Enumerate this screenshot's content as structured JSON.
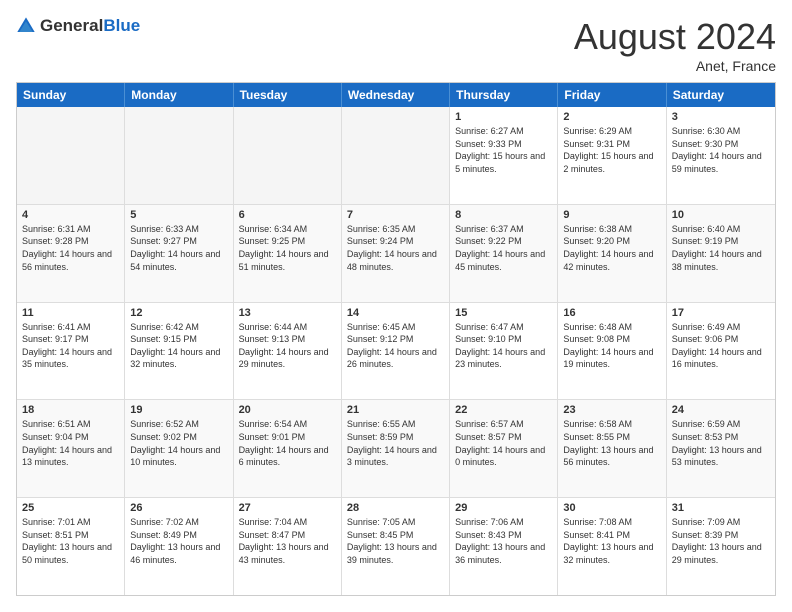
{
  "header": {
    "logo_general": "General",
    "logo_blue": "Blue",
    "month_year": "August 2024",
    "location": "Anet, France"
  },
  "days": [
    "Sunday",
    "Monday",
    "Tuesday",
    "Wednesday",
    "Thursday",
    "Friday",
    "Saturday"
  ],
  "rows": [
    [
      {
        "date": "",
        "empty": true
      },
      {
        "date": "",
        "empty": true
      },
      {
        "date": "",
        "empty": true
      },
      {
        "date": "",
        "empty": true
      },
      {
        "date": "1",
        "sunrise": "6:27 AM",
        "sunset": "9:33 PM",
        "daylight": "15 hours and 5 minutes."
      },
      {
        "date": "2",
        "sunrise": "6:29 AM",
        "sunset": "9:31 PM",
        "daylight": "15 hours and 2 minutes."
      },
      {
        "date": "3",
        "sunrise": "6:30 AM",
        "sunset": "9:30 PM",
        "daylight": "14 hours and 59 minutes."
      }
    ],
    [
      {
        "date": "4",
        "sunrise": "6:31 AM",
        "sunset": "9:28 PM",
        "daylight": "14 hours and 56 minutes."
      },
      {
        "date": "5",
        "sunrise": "6:33 AM",
        "sunset": "9:27 PM",
        "daylight": "14 hours and 54 minutes."
      },
      {
        "date": "6",
        "sunrise": "6:34 AM",
        "sunset": "9:25 PM",
        "daylight": "14 hours and 51 minutes."
      },
      {
        "date": "7",
        "sunrise": "6:35 AM",
        "sunset": "9:24 PM",
        "daylight": "14 hours and 48 minutes."
      },
      {
        "date": "8",
        "sunrise": "6:37 AM",
        "sunset": "9:22 PM",
        "daylight": "14 hours and 45 minutes."
      },
      {
        "date": "9",
        "sunrise": "6:38 AM",
        "sunset": "9:20 PM",
        "daylight": "14 hours and 42 minutes."
      },
      {
        "date": "10",
        "sunrise": "6:40 AM",
        "sunset": "9:19 PM",
        "daylight": "14 hours and 38 minutes."
      }
    ],
    [
      {
        "date": "11",
        "sunrise": "6:41 AM",
        "sunset": "9:17 PM",
        "daylight": "14 hours and 35 minutes."
      },
      {
        "date": "12",
        "sunrise": "6:42 AM",
        "sunset": "9:15 PM",
        "daylight": "14 hours and 32 minutes."
      },
      {
        "date": "13",
        "sunrise": "6:44 AM",
        "sunset": "9:13 PM",
        "daylight": "14 hours and 29 minutes."
      },
      {
        "date": "14",
        "sunrise": "6:45 AM",
        "sunset": "9:12 PM",
        "daylight": "14 hours and 26 minutes."
      },
      {
        "date": "15",
        "sunrise": "6:47 AM",
        "sunset": "9:10 PM",
        "daylight": "14 hours and 23 minutes."
      },
      {
        "date": "16",
        "sunrise": "6:48 AM",
        "sunset": "9:08 PM",
        "daylight": "14 hours and 19 minutes."
      },
      {
        "date": "17",
        "sunrise": "6:49 AM",
        "sunset": "9:06 PM",
        "daylight": "14 hours and 16 minutes."
      }
    ],
    [
      {
        "date": "18",
        "sunrise": "6:51 AM",
        "sunset": "9:04 PM",
        "daylight": "14 hours and 13 minutes."
      },
      {
        "date": "19",
        "sunrise": "6:52 AM",
        "sunset": "9:02 PM",
        "daylight": "14 hours and 10 minutes."
      },
      {
        "date": "20",
        "sunrise": "6:54 AM",
        "sunset": "9:01 PM",
        "daylight": "14 hours and 6 minutes."
      },
      {
        "date": "21",
        "sunrise": "6:55 AM",
        "sunset": "8:59 PM",
        "daylight": "14 hours and 3 minutes."
      },
      {
        "date": "22",
        "sunrise": "6:57 AM",
        "sunset": "8:57 PM",
        "daylight": "14 hours and 0 minutes."
      },
      {
        "date": "23",
        "sunrise": "6:58 AM",
        "sunset": "8:55 PM",
        "daylight": "13 hours and 56 minutes."
      },
      {
        "date": "24",
        "sunrise": "6:59 AM",
        "sunset": "8:53 PM",
        "daylight": "13 hours and 53 minutes."
      }
    ],
    [
      {
        "date": "25",
        "sunrise": "7:01 AM",
        "sunset": "8:51 PM",
        "daylight": "13 hours and 50 minutes."
      },
      {
        "date": "26",
        "sunrise": "7:02 AM",
        "sunset": "8:49 PM",
        "daylight": "13 hours and 46 minutes."
      },
      {
        "date": "27",
        "sunrise": "7:04 AM",
        "sunset": "8:47 PM",
        "daylight": "13 hours and 43 minutes."
      },
      {
        "date": "28",
        "sunrise": "7:05 AM",
        "sunset": "8:45 PM",
        "daylight": "13 hours and 39 minutes."
      },
      {
        "date": "29",
        "sunrise": "7:06 AM",
        "sunset": "8:43 PM",
        "daylight": "13 hours and 36 minutes."
      },
      {
        "date": "30",
        "sunrise": "7:08 AM",
        "sunset": "8:41 PM",
        "daylight": "13 hours and 32 minutes."
      },
      {
        "date": "31",
        "sunrise": "7:09 AM",
        "sunset": "8:39 PM",
        "daylight": "13 hours and 29 minutes."
      }
    ]
  ]
}
